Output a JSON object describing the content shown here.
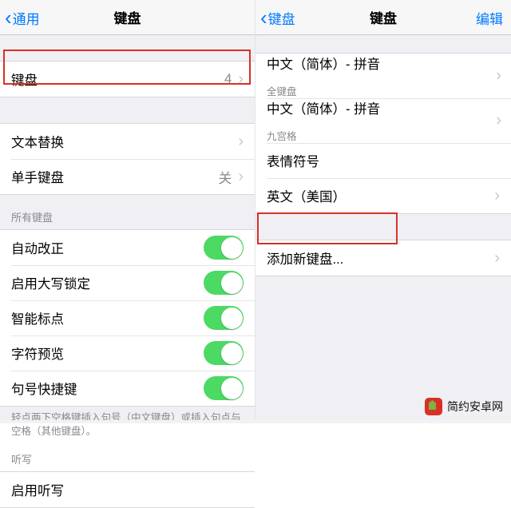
{
  "left": {
    "nav": {
      "back": "通用",
      "title": "键盘"
    },
    "keyboards": {
      "label": "键盘",
      "count": "4"
    },
    "text_replace": {
      "label": "文本替换"
    },
    "one_hand": {
      "label": "单手键盘",
      "value": "关"
    },
    "section_all": "所有键盘",
    "switches": {
      "auto_correct": "自动改正",
      "caps_lock": "启用大写锁定",
      "smart_punct": "智能标点",
      "char_preview": "字符预览",
      "period_shortcut": "句号快捷键"
    },
    "footer": "轻点两下空格键插入句号（中文键盘）或插入句点与空格（其他键盘）。",
    "section_dictation": "听写",
    "dictation_on": "启用听写"
  },
  "right": {
    "nav": {
      "back": "键盘",
      "title": "键盘",
      "edit": "编辑"
    },
    "items": [
      {
        "label": "中文（简体）- 拼音",
        "sub": "全键盘"
      },
      {
        "label": "中文（简体）- 拼音",
        "sub": "九宫格"
      },
      {
        "label": "表情符号"
      },
      {
        "label": "英文（美国）"
      }
    ],
    "add": "添加新键盘..."
  },
  "watermark": "简约安卓网"
}
